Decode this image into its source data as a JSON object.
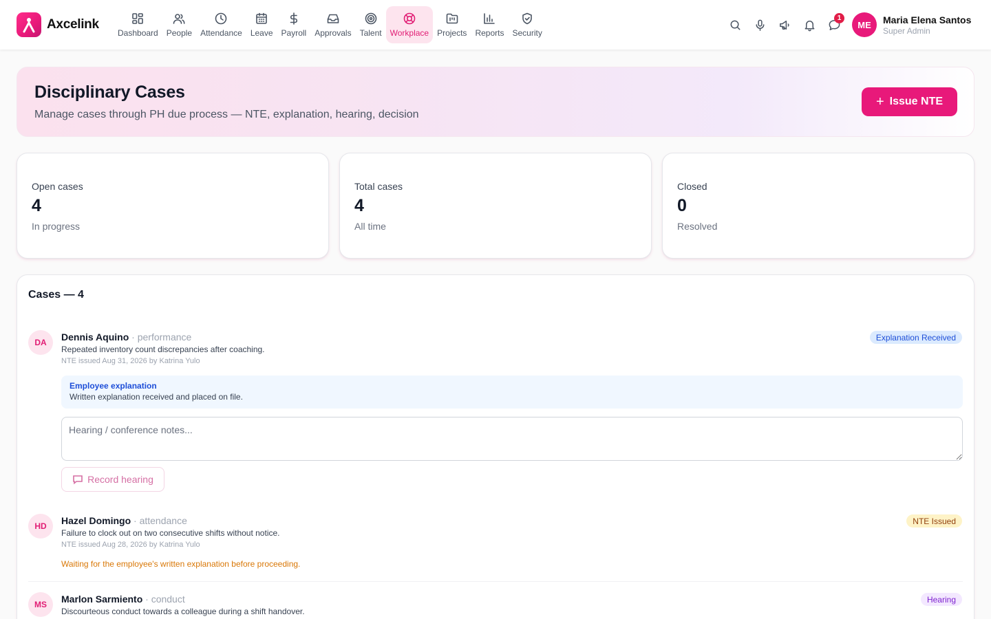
{
  "app": {
    "brand": "Axcelink"
  },
  "nav": [
    {
      "label": "Dashboard",
      "icon": "grid-icon"
    },
    {
      "label": "People",
      "icon": "users-icon"
    },
    {
      "label": "Attendance",
      "icon": "clock-icon"
    },
    {
      "label": "Leave",
      "icon": "calendar-icon"
    },
    {
      "label": "Payroll",
      "icon": "dollar-icon"
    },
    {
      "label": "Approvals",
      "icon": "inbox-icon"
    },
    {
      "label": "Talent",
      "icon": "target-icon"
    },
    {
      "label": "Workplace",
      "icon": "lifebuoy-icon",
      "active": true
    },
    {
      "label": "Projects",
      "icon": "kanban-icon"
    },
    {
      "label": "Reports",
      "icon": "bar-chart-icon"
    },
    {
      "label": "Security",
      "icon": "shield-icon"
    }
  ],
  "toolbar": {
    "messages_badge": "1"
  },
  "user": {
    "initials": "ME",
    "name": "Maria Elena Santos",
    "role": "Super Admin"
  },
  "header": {
    "title": "Disciplinary Cases",
    "subtitle": "Manage cases through PH due process — NTE, explanation, hearing, decision",
    "action_label": "Issue NTE"
  },
  "stats": [
    {
      "label": "Open cases",
      "value": "4",
      "sub": "In progress"
    },
    {
      "label": "Total cases",
      "value": "4",
      "sub": "All time"
    },
    {
      "label": "Closed",
      "value": "0",
      "sub": "Resolved"
    }
  ],
  "cases": {
    "title": "Cases — 4",
    "items": [
      {
        "initials": "DA",
        "name": "Dennis Aquino",
        "category": " · performance",
        "description": "Repeated inventory count discrepancies after coaching.",
        "meta": "NTE issued Aug 31, 2026 by Katrina Yulo",
        "status": "Explanation Received",
        "explanation_title": "Employee explanation",
        "explanation_body": "Written explanation received and placed on file.",
        "notes_placeholder": "Hearing / conference notes...",
        "action_label": "Record hearing"
      },
      {
        "initials": "HD",
        "name": "Hazel Domingo",
        "category": " · attendance",
        "description": "Failure to clock out on two consecutive shifts without notice.",
        "meta": "NTE issued Aug 28, 2026 by Katrina Yulo",
        "status": "NTE Issued",
        "note": "Waiting for the employee's written explanation before proceeding."
      },
      {
        "initials": "MS",
        "name": "Marlon Sarmiento",
        "category": " · conduct",
        "description": "Discourteous conduct towards a colleague during a shift handover.",
        "status": "Hearing"
      }
    ]
  },
  "colors": {
    "accent": "#e8197a",
    "active_bg": "#fde4ee",
    "status_blue": "#1d4ed8",
    "status_yellow": "#92400e",
    "status_purple": "#7e22ce",
    "waiting": "#d97706"
  }
}
